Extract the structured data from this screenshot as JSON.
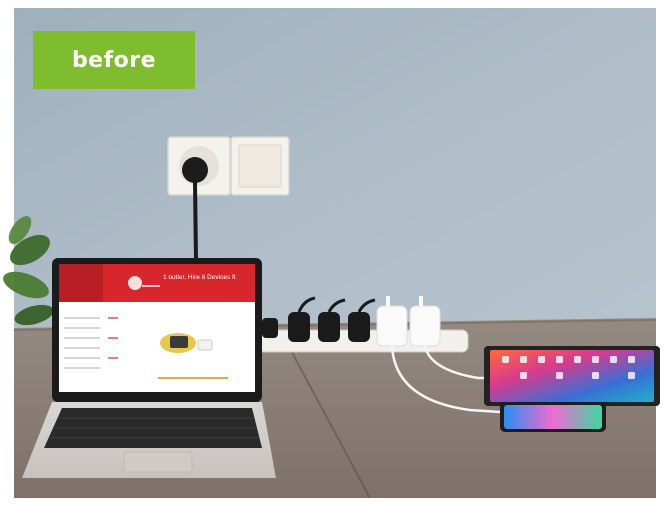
{
  "badge": {
    "label": "before"
  },
  "laptop": {
    "screen_heading": "1 outlet, Hire 8 Devices ft"
  },
  "colors": {
    "wall": "#a9b8c4",
    "desk": "#8a7d74",
    "badge": "#7dbd2f",
    "laptop_screen_header": "#d8262d"
  },
  "icons": [
    "wall-socket-icon",
    "plug-icon",
    "power-strip-icon",
    "charger-icon",
    "laptop-icon",
    "tablet-icon",
    "phone-icon"
  ]
}
